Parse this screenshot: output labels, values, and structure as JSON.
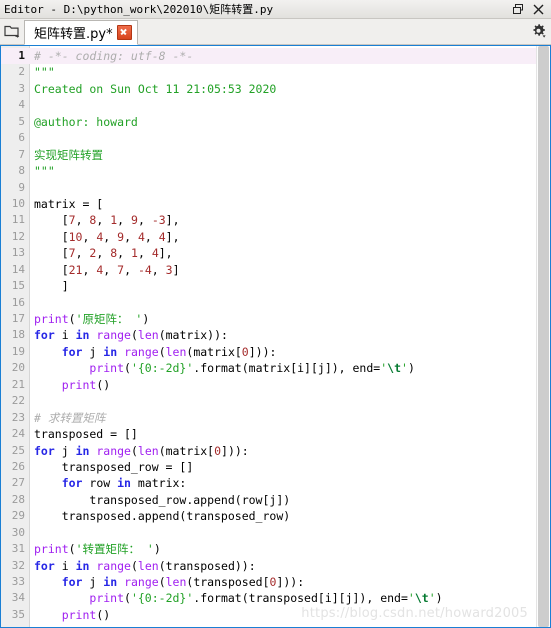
{
  "window": {
    "title": "Editor - D:\\python_work\\202010\\矩阵转置.py",
    "restore_icon": "restore-icon",
    "close_icon": "close-icon"
  },
  "tabbar": {
    "folder_icon": "folder-icon",
    "gear_icon": "gear-icon",
    "tabs": [
      {
        "label": "矩阵转置.py*",
        "modified": true,
        "active": true,
        "close_icon": "close-icon"
      }
    ]
  },
  "editor": {
    "language": "python",
    "current_line": 1,
    "first_line": 1,
    "total_lines": 35,
    "colors": {
      "comment": "#adadad",
      "string": "#22a126",
      "escape": "#067a31",
      "keyword": "#2727e6",
      "builtin": "#a020f0",
      "number": "#a42b2b",
      "text": "#000000",
      "gutter_bg": "#eeeeee",
      "current_line_bg": "#f8eef8",
      "border": "#1a7fd4"
    },
    "lines": [
      {
        "n": 1,
        "current": true,
        "tokens": [
          {
            "t": "# -*- coding: utf-8 -*-",
            "c": "c-comment"
          }
        ]
      },
      {
        "n": 2,
        "tokens": [
          {
            "t": "\"\"\"",
            "c": "c-string"
          }
        ]
      },
      {
        "n": 3,
        "tokens": [
          {
            "t": "Created on Sun Oct 11 21:05:53 2020",
            "c": "c-string"
          }
        ]
      },
      {
        "n": 4,
        "tokens": []
      },
      {
        "n": 5,
        "tokens": [
          {
            "t": "@author: howard",
            "c": "c-string"
          }
        ]
      },
      {
        "n": 6,
        "tokens": []
      },
      {
        "n": 7,
        "tokens": [
          {
            "t": "实现矩阵转置",
            "c": "c-string"
          }
        ]
      },
      {
        "n": 8,
        "tokens": [
          {
            "t": "\"\"\"",
            "c": "c-string"
          }
        ]
      },
      {
        "n": 9,
        "tokens": []
      },
      {
        "n": 10,
        "tokens": [
          {
            "t": "matrix = [",
            "c": "c-def"
          }
        ]
      },
      {
        "n": 11,
        "tokens": [
          {
            "t": "    [",
            "c": "c-def"
          },
          {
            "t": "7",
            "c": "c-num"
          },
          {
            "t": ", ",
            "c": "c-def"
          },
          {
            "t": "8",
            "c": "c-num"
          },
          {
            "t": ", ",
            "c": "c-def"
          },
          {
            "t": "1",
            "c": "c-num"
          },
          {
            "t": ", ",
            "c": "c-def"
          },
          {
            "t": "9",
            "c": "c-num"
          },
          {
            "t": ", ",
            "c": "c-def"
          },
          {
            "t": "-3",
            "c": "c-num"
          },
          {
            "t": "],",
            "c": "c-def"
          }
        ]
      },
      {
        "n": 12,
        "tokens": [
          {
            "t": "    [",
            "c": "c-def"
          },
          {
            "t": "10",
            "c": "c-num"
          },
          {
            "t": ", ",
            "c": "c-def"
          },
          {
            "t": "4",
            "c": "c-num"
          },
          {
            "t": ", ",
            "c": "c-def"
          },
          {
            "t": "9",
            "c": "c-num"
          },
          {
            "t": ", ",
            "c": "c-def"
          },
          {
            "t": "4",
            "c": "c-num"
          },
          {
            "t": ", ",
            "c": "c-def"
          },
          {
            "t": "4",
            "c": "c-num"
          },
          {
            "t": "],",
            "c": "c-def"
          }
        ]
      },
      {
        "n": 13,
        "tokens": [
          {
            "t": "    [",
            "c": "c-def"
          },
          {
            "t": "7",
            "c": "c-num"
          },
          {
            "t": ", ",
            "c": "c-def"
          },
          {
            "t": "2",
            "c": "c-num"
          },
          {
            "t": ", ",
            "c": "c-def"
          },
          {
            "t": "8",
            "c": "c-num"
          },
          {
            "t": ", ",
            "c": "c-def"
          },
          {
            "t": "1",
            "c": "c-num"
          },
          {
            "t": ", ",
            "c": "c-def"
          },
          {
            "t": "4",
            "c": "c-num"
          },
          {
            "t": "],",
            "c": "c-def"
          }
        ]
      },
      {
        "n": 14,
        "tokens": [
          {
            "t": "    [",
            "c": "c-def"
          },
          {
            "t": "21",
            "c": "c-num"
          },
          {
            "t": ", ",
            "c": "c-def"
          },
          {
            "t": "4",
            "c": "c-num"
          },
          {
            "t": ", ",
            "c": "c-def"
          },
          {
            "t": "7",
            "c": "c-num"
          },
          {
            "t": ", ",
            "c": "c-def"
          },
          {
            "t": "-4",
            "c": "c-num"
          },
          {
            "t": ", ",
            "c": "c-def"
          },
          {
            "t": "3",
            "c": "c-num"
          },
          {
            "t": "]",
            "c": "c-def"
          }
        ]
      },
      {
        "n": 15,
        "tokens": [
          {
            "t": "    ]",
            "c": "c-def"
          }
        ]
      },
      {
        "n": 16,
        "tokens": []
      },
      {
        "n": 17,
        "tokens": [
          {
            "t": "print",
            "c": "c-builtin"
          },
          {
            "t": "(",
            "c": "c-def"
          },
          {
            "t": "'原矩阵： '",
            "c": "c-string"
          },
          {
            "t": ")",
            "c": "c-def"
          }
        ]
      },
      {
        "n": 18,
        "tokens": [
          {
            "t": "for",
            "c": "c-kw"
          },
          {
            "t": " i ",
            "c": "c-def"
          },
          {
            "t": "in",
            "c": "c-kw"
          },
          {
            "t": " ",
            "c": "c-def"
          },
          {
            "t": "range",
            "c": "c-builtin"
          },
          {
            "t": "(",
            "c": "c-def"
          },
          {
            "t": "len",
            "c": "c-builtin"
          },
          {
            "t": "(matrix)):",
            "c": "c-def"
          }
        ]
      },
      {
        "n": 19,
        "tokens": [
          {
            "t": "    ",
            "c": "c-def"
          },
          {
            "t": "for",
            "c": "c-kw"
          },
          {
            "t": " j ",
            "c": "c-def"
          },
          {
            "t": "in",
            "c": "c-kw"
          },
          {
            "t": " ",
            "c": "c-def"
          },
          {
            "t": "range",
            "c": "c-builtin"
          },
          {
            "t": "(",
            "c": "c-def"
          },
          {
            "t": "len",
            "c": "c-builtin"
          },
          {
            "t": "(matrix[",
            "c": "c-def"
          },
          {
            "t": "0",
            "c": "c-num"
          },
          {
            "t": "])):",
            "c": "c-def"
          }
        ]
      },
      {
        "n": 20,
        "tokens": [
          {
            "t": "        ",
            "c": "c-def"
          },
          {
            "t": "print",
            "c": "c-builtin"
          },
          {
            "t": "(",
            "c": "c-def"
          },
          {
            "t": "'{0:-2d}'",
            "c": "c-string"
          },
          {
            "t": ".format(matrix[i][j]), end=",
            "c": "c-def"
          },
          {
            "t": "'",
            "c": "c-string"
          },
          {
            "t": "\\t",
            "c": "c-esc"
          },
          {
            "t": "'",
            "c": "c-string"
          },
          {
            "t": ")",
            "c": "c-def"
          }
        ]
      },
      {
        "n": 21,
        "tokens": [
          {
            "t": "    ",
            "c": "c-def"
          },
          {
            "t": "print",
            "c": "c-builtin"
          },
          {
            "t": "()",
            "c": "c-def"
          }
        ]
      },
      {
        "n": 22,
        "tokens": []
      },
      {
        "n": 23,
        "tokens": [
          {
            "t": "# 求转置矩阵",
            "c": "c-comment"
          }
        ]
      },
      {
        "n": 24,
        "tokens": [
          {
            "t": "transposed = []",
            "c": "c-def"
          }
        ]
      },
      {
        "n": 25,
        "tokens": [
          {
            "t": "for",
            "c": "c-kw"
          },
          {
            "t": " j ",
            "c": "c-def"
          },
          {
            "t": "in",
            "c": "c-kw"
          },
          {
            "t": " ",
            "c": "c-def"
          },
          {
            "t": "range",
            "c": "c-builtin"
          },
          {
            "t": "(",
            "c": "c-def"
          },
          {
            "t": "len",
            "c": "c-builtin"
          },
          {
            "t": "(matrix[",
            "c": "c-def"
          },
          {
            "t": "0",
            "c": "c-num"
          },
          {
            "t": "])):",
            "c": "c-def"
          }
        ]
      },
      {
        "n": 26,
        "tokens": [
          {
            "t": "    transposed_row = []",
            "c": "c-def"
          }
        ]
      },
      {
        "n": 27,
        "tokens": [
          {
            "t": "    ",
            "c": "c-def"
          },
          {
            "t": "for",
            "c": "c-kw"
          },
          {
            "t": " row ",
            "c": "c-def"
          },
          {
            "t": "in",
            "c": "c-kw"
          },
          {
            "t": " matrix:",
            "c": "c-def"
          }
        ]
      },
      {
        "n": 28,
        "tokens": [
          {
            "t": "        transposed_row.append(row[j])",
            "c": "c-def"
          }
        ]
      },
      {
        "n": 29,
        "tokens": [
          {
            "t": "    transposed.append(transposed_row)",
            "c": "c-def"
          }
        ]
      },
      {
        "n": 30,
        "tokens": []
      },
      {
        "n": 31,
        "tokens": [
          {
            "t": "print",
            "c": "c-builtin"
          },
          {
            "t": "(",
            "c": "c-def"
          },
          {
            "t": "'转置矩阵： '",
            "c": "c-string"
          },
          {
            "t": ")",
            "c": "c-def"
          }
        ]
      },
      {
        "n": 32,
        "tokens": [
          {
            "t": "for",
            "c": "c-kw"
          },
          {
            "t": " i ",
            "c": "c-def"
          },
          {
            "t": "in",
            "c": "c-kw"
          },
          {
            "t": " ",
            "c": "c-def"
          },
          {
            "t": "range",
            "c": "c-builtin"
          },
          {
            "t": "(",
            "c": "c-def"
          },
          {
            "t": "len",
            "c": "c-builtin"
          },
          {
            "t": "(transposed)):",
            "c": "c-def"
          }
        ]
      },
      {
        "n": 33,
        "tokens": [
          {
            "t": "    ",
            "c": "c-def"
          },
          {
            "t": "for",
            "c": "c-kw"
          },
          {
            "t": " j ",
            "c": "c-def"
          },
          {
            "t": "in",
            "c": "c-kw"
          },
          {
            "t": " ",
            "c": "c-def"
          },
          {
            "t": "range",
            "c": "c-builtin"
          },
          {
            "t": "(",
            "c": "c-def"
          },
          {
            "t": "len",
            "c": "c-builtin"
          },
          {
            "t": "(transposed[",
            "c": "c-def"
          },
          {
            "t": "0",
            "c": "c-num"
          },
          {
            "t": "])):",
            "c": "c-def"
          }
        ]
      },
      {
        "n": 34,
        "tokens": [
          {
            "t": "        ",
            "c": "c-def"
          },
          {
            "t": "print",
            "c": "c-builtin"
          },
          {
            "t": "(",
            "c": "c-def"
          },
          {
            "t": "'{0:-2d}'",
            "c": "c-string"
          },
          {
            "t": ".format(transposed[i][j]), end=",
            "c": "c-def"
          },
          {
            "t": "'",
            "c": "c-string"
          },
          {
            "t": "\\t",
            "c": "c-esc"
          },
          {
            "t": "'",
            "c": "c-string"
          },
          {
            "t": ")",
            "c": "c-def"
          }
        ]
      },
      {
        "n": 35,
        "tokens": [
          {
            "t": "    ",
            "c": "c-def"
          },
          {
            "t": "print",
            "c": "c-builtin"
          },
          {
            "t": "()",
            "c": "c-def"
          }
        ]
      }
    ]
  },
  "watermark": {
    "text": "https://blog.csdn.net/howard2005"
  }
}
